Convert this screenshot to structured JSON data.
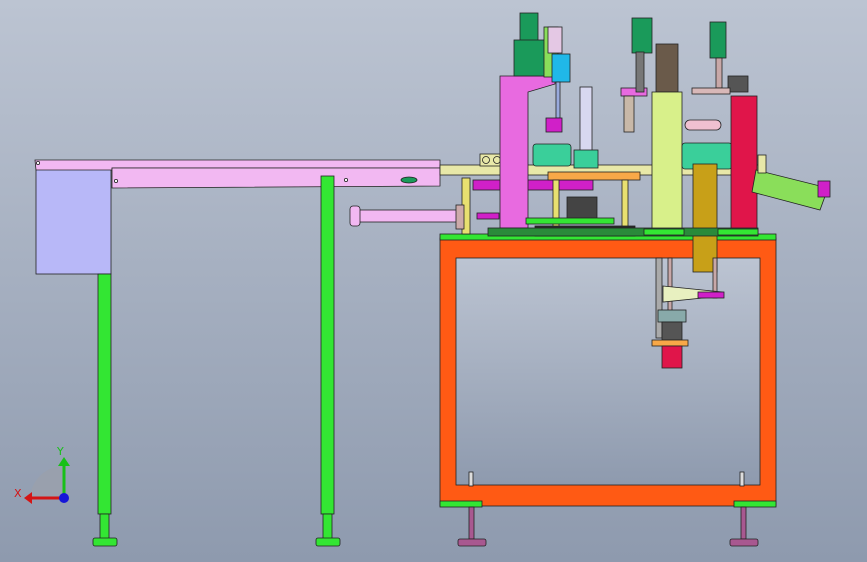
{
  "viewport": {
    "background_top": "#bcc4d2",
    "background_bottom": "#8e9aae"
  },
  "triad": {
    "x_label": "X",
    "y_label": "Y",
    "x_color": "#d41414",
    "y_color": "#18c018",
    "z_color": "#1616d8"
  },
  "colors": {
    "frame": "#ff5a14",
    "frame_edge": "#8a2a00",
    "legs": "#33e633",
    "conveyor": "#f2b8f2",
    "hopper": "#b8b8f8",
    "motor": "#1a9a5a",
    "pink_column": "#e86ae0",
    "red_column": "#e0154a",
    "yellow_green": "#d8f08a",
    "gold": "#c8a018",
    "feet": "#a85890",
    "chute": "#8ade5a",
    "cyan": "#20b8e8",
    "orange_plate": "#f8a848",
    "teal_drum": "#3acf9a",
    "magenta": "#d020c8"
  }
}
